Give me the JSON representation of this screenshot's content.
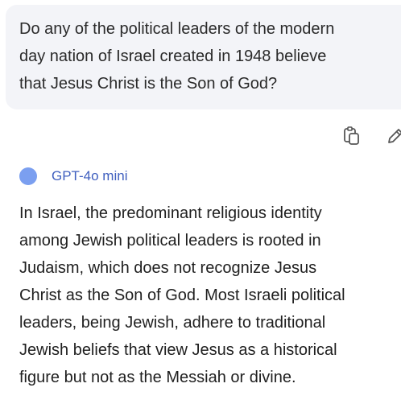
{
  "user_message": {
    "lines": [
      "Do any of the political leaders of the modern",
      "day nation of Israel created in 1948 believe",
      "that Jesus Christ is the Son of God?"
    ]
  },
  "message_actions": {
    "copy_icon": "copy-icon",
    "edit_icon": "pencil-icon"
  },
  "assistant": {
    "model_name": "GPT-4o mini",
    "avatar_color": "#7b9ff0",
    "response_lines": [
      "In Israel, the predominant religious identity",
      "among Jewish political leaders is rooted in",
      "Judaism, which does not recognize Jesus",
      "Christ as the Son of God. Most Israeli political",
      "leaders, being Jewish, adhere to traditional",
      "Jewish beliefs that view Jesus as a historical",
      "figure but not as the Messiah or divine."
    ]
  },
  "colors": {
    "bubble_bg": "#f3f4f8",
    "model_name": "#3f5fbf",
    "icon": "#555555"
  }
}
